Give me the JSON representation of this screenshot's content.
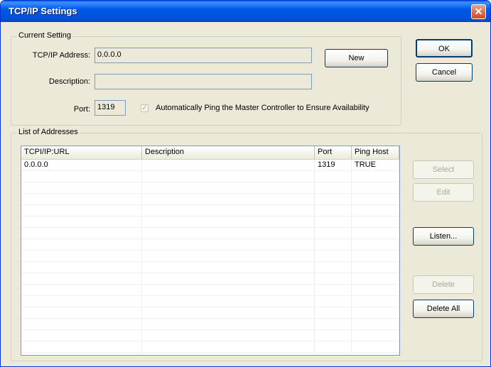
{
  "window": {
    "title": "TCP/IP Settings",
    "close_glyph": "✕"
  },
  "current_setting": {
    "legend": "Current Setting",
    "tcpip_label": "TCP/IP Address:",
    "tcpip_value": "0.0.0.0",
    "description_label": "Description:",
    "description_value": "",
    "port_label": "Port:",
    "port_value": "1319",
    "ping_checkbox_label": "Automatically Ping the Master Controller to Ensure Availability",
    "ping_checked": true,
    "check_glyph": "✓",
    "new_button": "New"
  },
  "dialog_buttons": {
    "ok": "OK",
    "cancel": "Cancel"
  },
  "addresses": {
    "legend": "List of Addresses",
    "columns": [
      "TCPI/IP:URL",
      "Description",
      "Port",
      "Ping Host"
    ],
    "rows": [
      [
        "0.0.0.0",
        "",
        "1319",
        "TRUE"
      ]
    ],
    "empty_rows": 17
  },
  "side_buttons": {
    "select": "Select",
    "edit": "Edit",
    "listen": "Listen...",
    "delete": "Delete",
    "delete_all": "Delete All"
  }
}
